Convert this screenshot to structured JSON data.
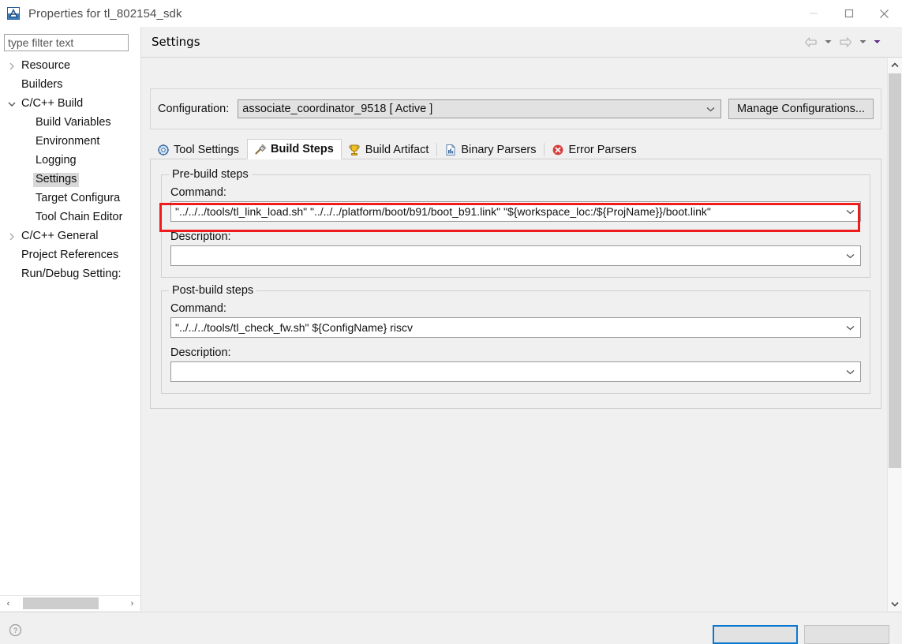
{
  "window": {
    "title": "Properties for tl_802154_sdk",
    "app_icon": "eclipse-a-icon",
    "minimize_label": "—",
    "maximize_label": "□",
    "close_label": "✕"
  },
  "sidebar": {
    "filter_placeholder": "type filter text",
    "filter_value": "",
    "items": [
      {
        "label": "Resource",
        "level": 0,
        "arrow": "collapsed",
        "selected": false
      },
      {
        "label": "Builders",
        "level": 0,
        "arrow": "none",
        "selected": false
      },
      {
        "label": "C/C++ Build",
        "level": 0,
        "arrow": "expanded",
        "selected": false
      },
      {
        "label": "Build Variables",
        "level": 1,
        "arrow": "none",
        "selected": false
      },
      {
        "label": "Environment",
        "level": 1,
        "arrow": "none",
        "selected": false
      },
      {
        "label": "Logging",
        "level": 1,
        "arrow": "none",
        "selected": false
      },
      {
        "label": "Settings",
        "level": 1,
        "arrow": "none",
        "selected": true
      },
      {
        "label": "Target Configura",
        "level": 1,
        "arrow": "none",
        "selected": false
      },
      {
        "label": "Tool Chain Editor",
        "level": 1,
        "arrow": "none",
        "selected": false
      },
      {
        "label": "C/C++ General",
        "level": 0,
        "arrow": "collapsed",
        "selected": false
      },
      {
        "label": "Project References",
        "level": 0,
        "arrow": "none",
        "selected": false
      },
      {
        "label": "Run/Debug Setting:",
        "level": 0,
        "arrow": "none",
        "selected": false
      }
    ]
  },
  "page": {
    "title": "Settings",
    "nav": {
      "back_icon": "arrow-left-icon",
      "back_caret_icon": "chevron-down-icon",
      "forward_icon": "arrow-right-icon",
      "forward_caret_icon": "chevron-down-icon",
      "menu_caret_icon": "chevron-down-filled-icon"
    }
  },
  "configuration": {
    "label": "Configuration:",
    "value": "associate_coordinator_9518  [ Active ]",
    "caret_icon": "chevron-down-icon",
    "manage_button": "Manage Configurations..."
  },
  "tabs": [
    {
      "label": "Tool Settings",
      "icon": "tool-settings-icon",
      "active": false
    },
    {
      "label": "Build Steps",
      "icon": "build-steps-icon",
      "active": true
    },
    {
      "label": "Build Artifact",
      "icon": "build-artifact-icon",
      "active": false
    },
    {
      "label": "Binary Parsers",
      "icon": "binary-parsers-icon",
      "active": false
    },
    {
      "label": "Error Parsers",
      "icon": "error-parsers-icon",
      "active": false
    }
  ],
  "prebuild": {
    "legend": "Pre-build steps",
    "command_label": "Command:",
    "command_value": "\"../../../tools/tl_link_load.sh\" \"../../../platform/boot/b91/boot_b91.link\" \"${workspace_loc:/${ProjName}}/boot.link\"",
    "description_label": "Description:",
    "description_value": "",
    "caret_icon": "chevron-down-icon"
  },
  "postbuild": {
    "legend": "Post-build steps",
    "command_label": "Command:",
    "command_value": "\"../../../tools/tl_check_fw.sh\" ${ConfigName} riscv",
    "description_label": "Description:",
    "description_value": "",
    "caret_icon": "chevron-down-icon"
  },
  "annotation": {
    "color": "#ee1c1c",
    "target": "prebuild-command-combo"
  },
  "footer": {
    "help_icon": "help-icon",
    "primary_button": "",
    "secondary_button": ""
  },
  "scrollbars": {
    "sidebar_left_arrow": "‹",
    "sidebar_right_arrow": "›",
    "content_up_arrow": "chevron-up-icon",
    "content_down_arrow": "chevron-down-icon"
  }
}
